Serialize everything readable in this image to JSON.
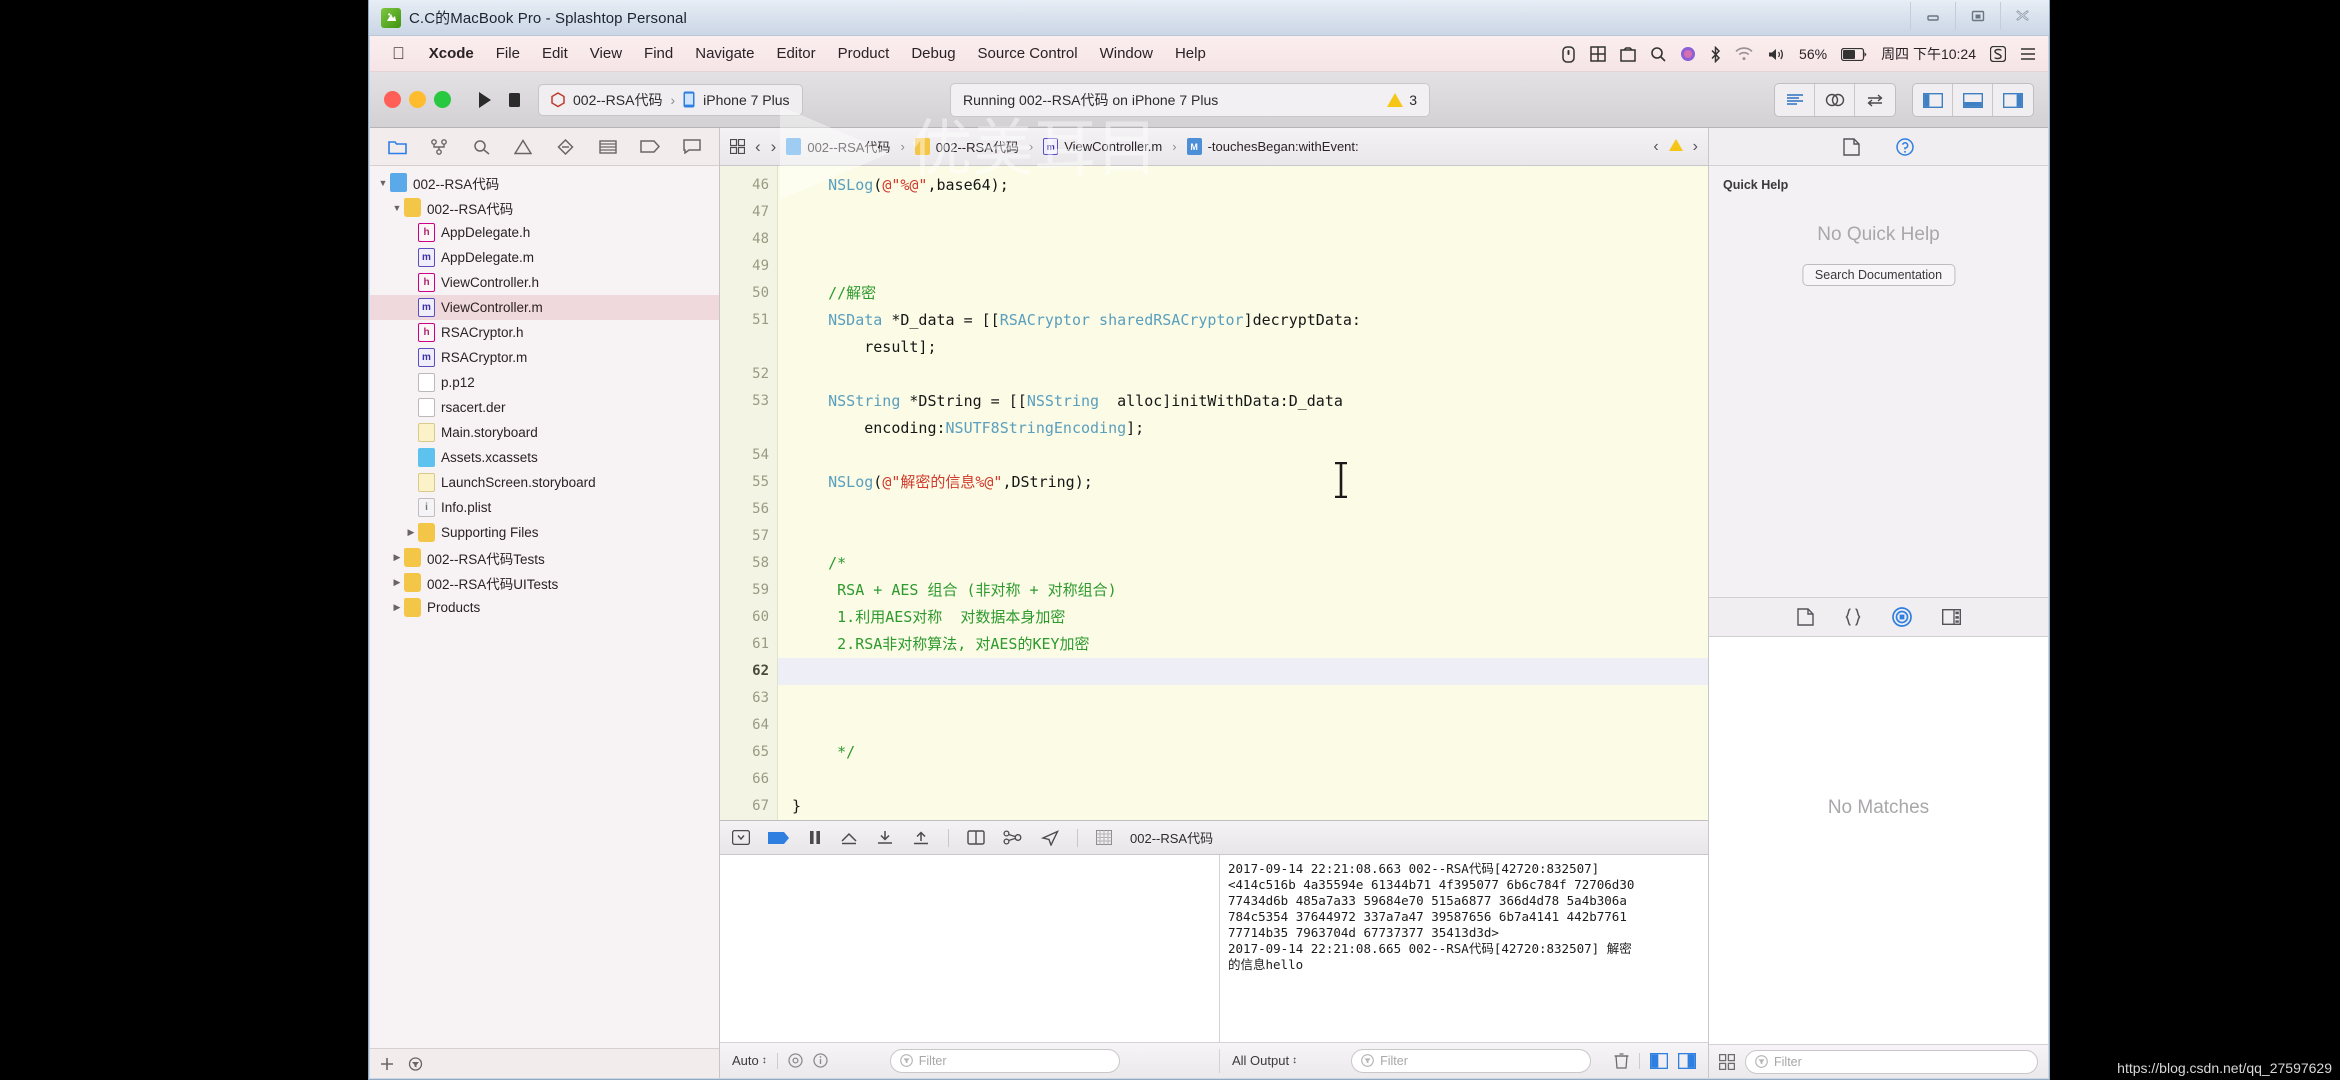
{
  "window": {
    "title": "C.C的MacBook Pro - Splashtop Personal",
    "app_icon": "splashtop-icon",
    "buttons": [
      {
        "name": "minimize",
        "glyph": "minimize-icon"
      },
      {
        "name": "maximize",
        "glyph": "maximize-icon"
      },
      {
        "name": "close",
        "glyph": "close-icon"
      }
    ]
  },
  "mac_menubar": {
    "apple": "",
    "items": [
      {
        "label": "Xcode",
        "bold": true
      },
      {
        "label": "File",
        "bold": false
      },
      {
        "label": "Edit",
        "bold": false
      },
      {
        "label": "View",
        "bold": false
      },
      {
        "label": "Find",
        "bold": false
      },
      {
        "label": "Navigate",
        "bold": false
      },
      {
        "label": "Editor",
        "bold": false
      },
      {
        "label": "Product",
        "bold": false
      },
      {
        "label": "Debug",
        "bold": false
      },
      {
        "label": "Source Control",
        "bold": false
      },
      {
        "label": "Window",
        "bold": false
      },
      {
        "label": "Help",
        "bold": false
      }
    ],
    "status_icons": [
      "usb-icon",
      "grid-icon",
      "screenshot-icon",
      "spotlight-search-icon",
      "siri-icon",
      "bluetooth-icon",
      "wifi-icon",
      "volume-icon"
    ],
    "battery": "56%",
    "clock": "周四 下午10:24",
    "right_icons": [
      "sogou-input-icon",
      "notification-center-icon"
    ]
  },
  "xcode_toolbar": {
    "traffic_lights": [
      "close",
      "minimize",
      "zoom"
    ],
    "run_button": "run-icon",
    "stop_button": "stop-icon",
    "scheme_name": "002--RSA代码",
    "scheme_sep": "›",
    "destination": "iPhone 7 Plus",
    "status_text": "Running 002--RSA代码 on iPhone 7 Plus",
    "warning_count": "3",
    "editor_segment": [
      "standard-editor-icon",
      "assistant-editor-icon",
      "version-editor-icon"
    ],
    "view_segment": [
      "navigator-toggle-icon",
      "debug-area-toggle-icon",
      "utilities-toggle-icon"
    ]
  },
  "navigator": {
    "tabs": [
      "project-navigator-icon",
      "source-control-navigator-icon",
      "find-navigator-icon",
      "issue-navigator-icon",
      "test-navigator-icon",
      "debug-navigator-icon",
      "breakpoint-navigator-icon",
      "report-navigator-icon"
    ],
    "active_tab_index": 0,
    "tree": [
      {
        "label": "002--RSA代码",
        "indent": 0,
        "twisty": "down",
        "icon": "project",
        "selected": false
      },
      {
        "label": "002--RSA代码",
        "indent": 1,
        "twisty": "down",
        "icon": "folder",
        "selected": false
      },
      {
        "label": "AppDelegate.h",
        "indent": 2,
        "twisty": "",
        "icon": "h",
        "selected": false
      },
      {
        "label": "AppDelegate.m",
        "indent": 2,
        "twisty": "",
        "icon": "m",
        "selected": false
      },
      {
        "label": "ViewController.h",
        "indent": 2,
        "twisty": "",
        "icon": "h",
        "selected": false
      },
      {
        "label": "ViewController.m",
        "indent": 2,
        "twisty": "",
        "icon": "m",
        "selected": true
      },
      {
        "label": "RSACryptor.h",
        "indent": 2,
        "twisty": "",
        "icon": "h",
        "selected": false
      },
      {
        "label": "RSACryptor.m",
        "indent": 2,
        "twisty": "",
        "icon": "m",
        "selected": false
      },
      {
        "label": "p.p12",
        "indent": 2,
        "twisty": "",
        "icon": "blank",
        "selected": false
      },
      {
        "label": "rsacert.der",
        "indent": 2,
        "twisty": "",
        "icon": "blank",
        "selected": false
      },
      {
        "label": "Main.storyboard",
        "indent": 2,
        "twisty": "",
        "icon": "sb",
        "selected": false
      },
      {
        "label": "Assets.xcassets",
        "indent": 2,
        "twisty": "",
        "icon": "assets",
        "selected": false
      },
      {
        "label": "LaunchScreen.storyboard",
        "indent": 2,
        "twisty": "",
        "icon": "sb",
        "selected": false
      },
      {
        "label": "Info.plist",
        "indent": 2,
        "twisty": "",
        "icon": "plist",
        "selected": false
      },
      {
        "label": "Supporting Files",
        "indent": 2,
        "twisty": "right",
        "icon": "folder",
        "selected": false
      },
      {
        "label": "002--RSA代码Tests",
        "indent": 1,
        "twisty": "right",
        "icon": "folder",
        "selected": false
      },
      {
        "label": "002--RSA代码UITests",
        "indent": 1,
        "twisty": "right",
        "icon": "folder",
        "selected": false
      },
      {
        "label": "Products",
        "indent": 1,
        "twisty": "right",
        "icon": "folder",
        "selected": false
      }
    ],
    "footer_icons": [
      "add-icon",
      "filter-icon"
    ]
  },
  "jump_bar": {
    "related_items_icon": "related-items-icon",
    "back_label": "‹",
    "forward_label": "›",
    "crumbs": [
      {
        "label": "002--RSA代码",
        "icon": "project"
      },
      {
        "label": "002--RSA代码",
        "icon": "folder"
      },
      {
        "label": "ViewController.m",
        "icon": "m"
      },
      {
        "label": "-touchesBegan:withEvent:",
        "icon": "method"
      }
    ],
    "right_icons": [
      "prev-issue-icon",
      "warning-icon",
      "next-issue-icon"
    ]
  },
  "editor": {
    "first_line": 46,
    "current_line": 62,
    "lines": [
      {
        "n": 46,
        "segments": [
          {
            "t": "    ",
            "c": "pln"
          },
          {
            "t": "NSLog",
            "c": "ty"
          },
          {
            "t": "(",
            "c": "pln"
          },
          {
            "t": "@\"%@\"",
            "c": "str"
          },
          {
            "t": ",base64);",
            "c": "pln"
          }
        ]
      },
      {
        "n": 47,
        "segments": []
      },
      {
        "n": 48,
        "segments": []
      },
      {
        "n": 49,
        "segments": []
      },
      {
        "n": 50,
        "segments": [
          {
            "t": "    ",
            "c": "pln"
          },
          {
            "t": "//解密",
            "c": "cmt"
          }
        ]
      },
      {
        "n": 51,
        "segments": [
          {
            "t": "    ",
            "c": "pln"
          },
          {
            "t": "NSData",
            "c": "ty"
          },
          {
            "t": " *D_data = [[",
            "c": "pln"
          },
          {
            "t": "RSACryptor sharedRSACryptor",
            "c": "ty"
          },
          {
            "t": "]decryptData:",
            "c": "pln"
          }
        ]
      },
      {
        "n": null,
        "segments": [
          {
            "t": "        result];",
            "c": "pln"
          }
        ]
      },
      {
        "n": 52,
        "segments": []
      },
      {
        "n": 53,
        "segments": [
          {
            "t": "    ",
            "c": "pln"
          },
          {
            "t": "NSString",
            "c": "ty"
          },
          {
            "t": " *DString = [[",
            "c": "pln"
          },
          {
            "t": "NSString",
            "c": "ty"
          },
          {
            "t": "  alloc]initWithData:D_data",
            "c": "pln"
          }
        ]
      },
      {
        "n": null,
        "segments": [
          {
            "t": "        encoding:",
            "c": "pln"
          },
          {
            "t": "NSUTF8StringEncoding",
            "c": "ty"
          },
          {
            "t": "];",
            "c": "pln"
          }
        ]
      },
      {
        "n": 54,
        "segments": []
      },
      {
        "n": 55,
        "segments": [
          {
            "t": "    ",
            "c": "pln"
          },
          {
            "t": "NSLog",
            "c": "ty"
          },
          {
            "t": "(",
            "c": "pln"
          },
          {
            "t": "@\"解密的信息%@\"",
            "c": "str"
          },
          {
            "t": ",DString);",
            "c": "pln"
          }
        ]
      },
      {
        "n": 56,
        "segments": []
      },
      {
        "n": 57,
        "segments": []
      },
      {
        "n": 58,
        "segments": [
          {
            "t": "    /*",
            "c": "cmt"
          }
        ]
      },
      {
        "n": 59,
        "segments": [
          {
            "t": "     RSA + AES 组合 (非对称 + 对称组合)",
            "c": "cmt"
          }
        ]
      },
      {
        "n": 60,
        "segments": [
          {
            "t": "     1.利用AES对称  对数据本身加密",
            "c": "cmt"
          }
        ]
      },
      {
        "n": 61,
        "segments": [
          {
            "t": "     2.RSA非对称算法, 对AES的KEY加密",
            "c": "cmt"
          }
        ]
      },
      {
        "n": 62,
        "segments": [],
        "highlight": true
      },
      {
        "n": 63,
        "segments": []
      },
      {
        "n": 64,
        "segments": []
      },
      {
        "n": 65,
        "segments": [
          {
            "t": "     */",
            "c": "cmt"
          }
        ]
      },
      {
        "n": 66,
        "segments": []
      },
      {
        "n": 67,
        "segments": [
          {
            "t": "}",
            "c": "pln"
          }
        ]
      }
    ]
  },
  "debug": {
    "toolbar_icons": [
      "hide-debug-area-icon",
      "breakpoints-toggle-icon",
      "pause-icon",
      "step-over-icon",
      "step-into-icon",
      "step-out-icon",
      "view-hierarchy-icon",
      "memory-graph-icon",
      "location-simulate-icon"
    ],
    "process_label": "002--RSA代码",
    "console_text": "2017-09-14 22:21:08.663 002--RSA代码[42720:832507]\n<414c516b 4a35594e 61344b71 4f395077 6b6c784f 72706d30\n77434d6b 485a7a33 59684e70 515a6877 366d4d78 5a4b306a\n784c5354 37644972 337a7a47 39587656 6b7a4141 442b7761\n77714b35 7963704d 67737377 35413d3d>\n2017-09-14 22:21:08.665 002--RSA代码[42720:832507] 解密\n的信息hello",
    "footer": {
      "auto_label": "Auto",
      "variable_scope_icons": [
        "scope-icon",
        "info-icon"
      ],
      "left_filter_placeholder": "Filter",
      "output_label": "All Output",
      "right_filter_placeholder": "Filter",
      "trash_icon": "trash-icon",
      "split_icons": [
        "show-variables-icon",
        "show-console-icon"
      ]
    }
  },
  "utilities": {
    "tabs": [
      "file-inspector-icon",
      "quick-help-inspector-icon"
    ],
    "quick_help_title": "Quick Help",
    "quick_help_empty": "No Quick Help",
    "search_documentation": "Search Documentation",
    "library_tabs": [
      "file-template-library-icon",
      "code-snippet-library-icon",
      "object-library-icon",
      "media-library-icon"
    ],
    "active_library_index": 2,
    "library_empty": "No Matches",
    "footer_icons": [
      "library-grid-icon"
    ],
    "footer_filter_placeholder": "Filter"
  },
  "overlay": {
    "watermark_text": "优美耳目",
    "csdn_url": "https://blog.csdn.net/qq_27597629"
  }
}
